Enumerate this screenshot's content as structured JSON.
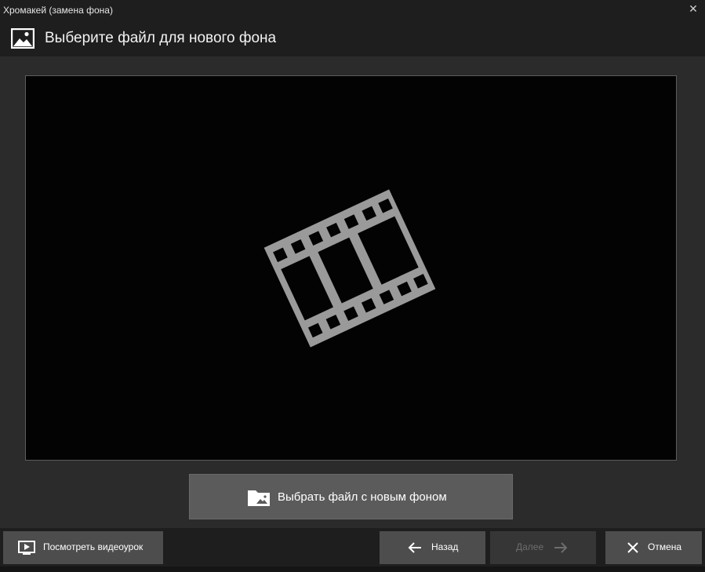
{
  "window": {
    "title": "Хромакей (замена фона)",
    "close_symbol": "✕"
  },
  "header": {
    "icon": "image-icon",
    "text": "Выберите файл для нового фона"
  },
  "preview": {
    "icon": "film-strip-icon"
  },
  "choose_button": {
    "icon": "folder-image-icon",
    "label": "Выбрать файл с новым фоном"
  },
  "footer": {
    "tutorial": {
      "icon": "video-play-icon",
      "label": "Посмотреть видеоурок"
    },
    "back": {
      "icon": "arrow-left-icon",
      "label": "Назад"
    },
    "next": {
      "icon": "arrow-right-icon",
      "label": "Далее",
      "enabled": false
    },
    "cancel": {
      "icon": "close-icon",
      "label": "Отмена"
    }
  },
  "colors": {
    "background": "#2b2b2b",
    "bar": "#1e1e1e",
    "preview_bg": "#030303",
    "film_icon": "#9a9a9a",
    "button": "#5b5b5b",
    "footer_button": "#4d4d4d",
    "disabled_text": "#6d6d6d"
  }
}
